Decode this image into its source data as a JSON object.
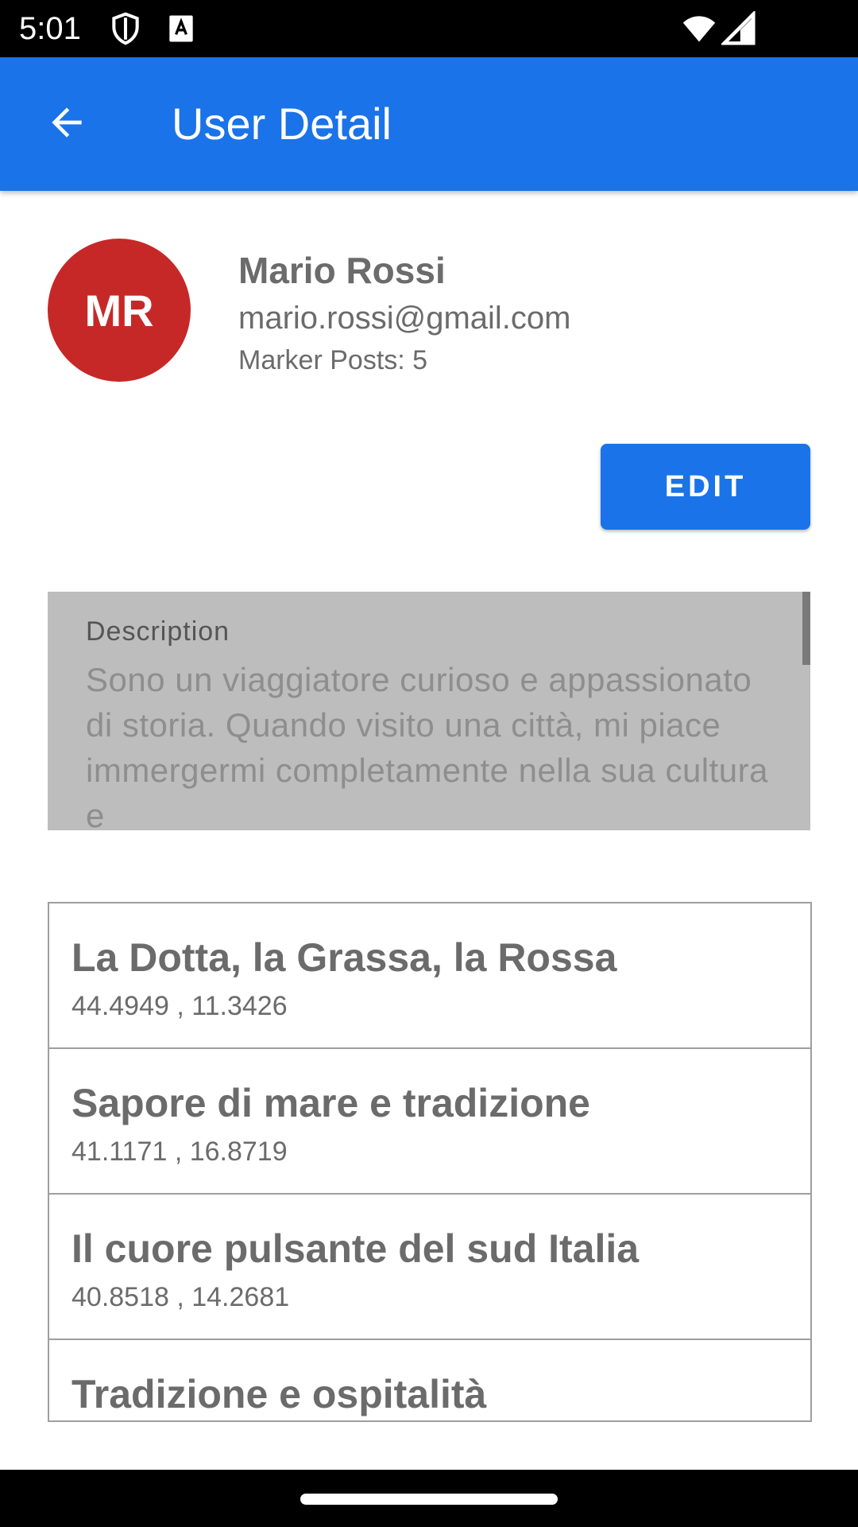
{
  "status_bar": {
    "time": "5:01",
    "icons": [
      "shield-icon",
      "font-icon",
      "wifi-icon",
      "signal-icon"
    ]
  },
  "app_bar": {
    "title": "User Detail",
    "back_icon": "arrow-back-icon",
    "color": "#1a73e8"
  },
  "profile": {
    "initials": "MR",
    "avatar_color": "#c62828",
    "name": "Mario Rossi",
    "email": "mario.rossi@gmail.com",
    "posts": "Marker Posts: 5"
  },
  "actions": {
    "edit_label": "EDIT"
  },
  "description": {
    "label": "Description",
    "text": "Sono un viaggiatore curioso e appassionato di storia. Quando visito una città, mi piace immergermi completamente nella sua cultura e"
  },
  "markers": [
    {
      "title": "La Dotta, la Grassa, la Rossa",
      "coords": "44.4949 , 11.3426"
    },
    {
      "title": "Sapore di mare e tradizione",
      "coords": "41.1171 , 16.8719"
    },
    {
      "title": "Il cuore pulsante del sud Italia",
      "coords": "40.8518 , 14.2681"
    },
    {
      "title": "Tradizione e ospitalità",
      "coords": ""
    }
  ]
}
